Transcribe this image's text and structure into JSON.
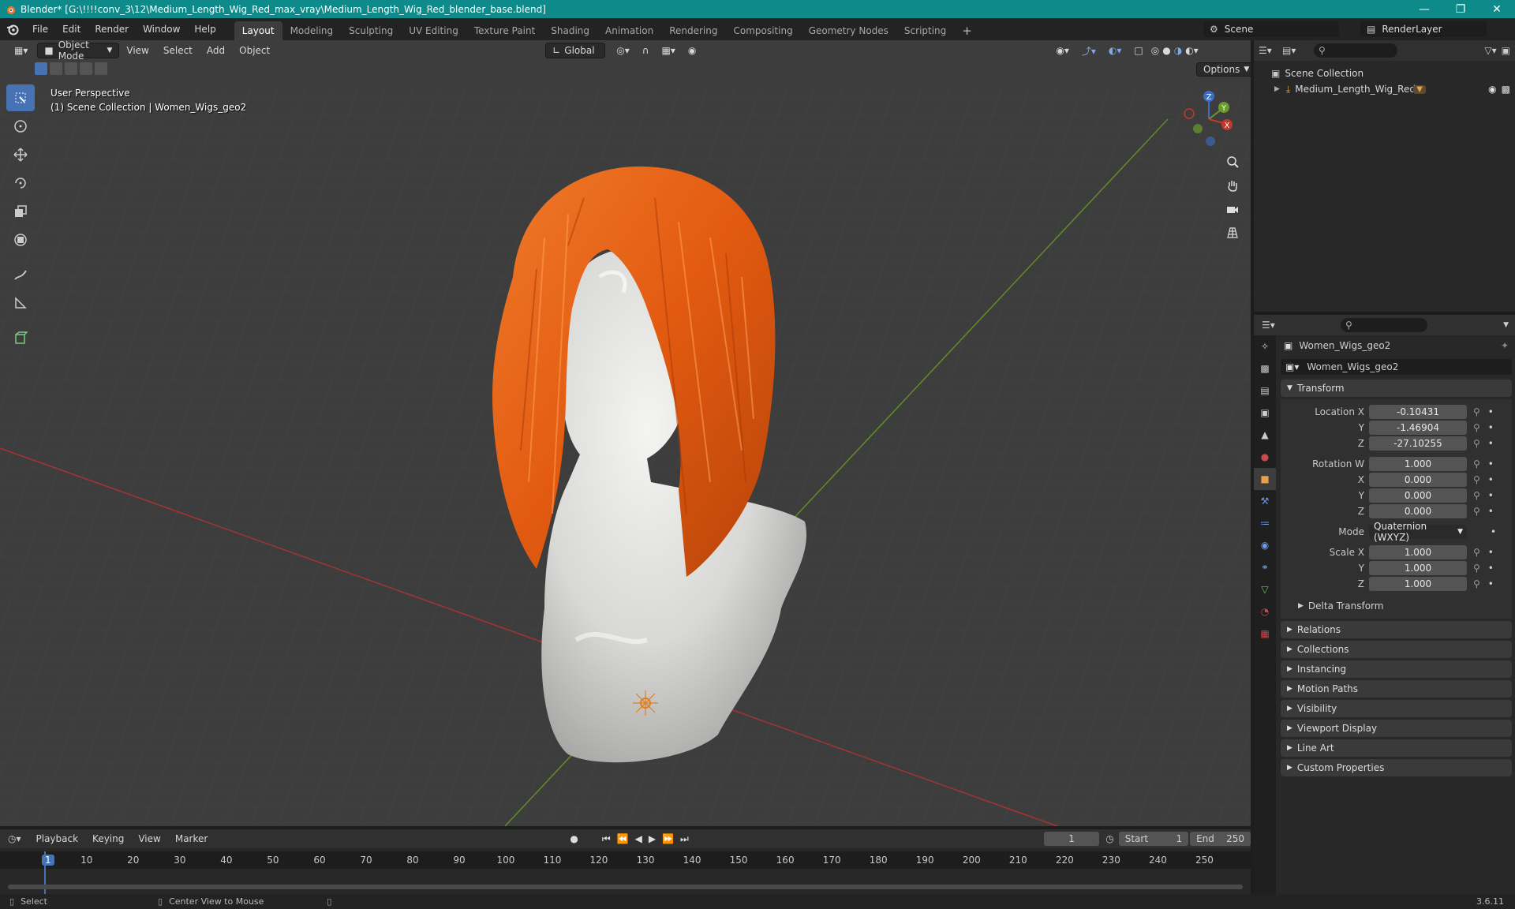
{
  "window": {
    "title": "Blender* [G:\\!!!!conv_3\\12\\Medium_Length_Wig_Red_max_vray\\Medium_Length_Wig_Red_blender_base.blend]"
  },
  "menus": [
    "File",
    "Edit",
    "Render",
    "Window",
    "Help"
  ],
  "workspace_tabs": [
    "Layout",
    "Modeling",
    "Sculpting",
    "UV Editing",
    "Texture Paint",
    "Shading",
    "Animation",
    "Rendering",
    "Compositing",
    "Geometry Nodes",
    "Scripting"
  ],
  "scene": {
    "name": "Scene",
    "render_layer": "RenderLayer"
  },
  "viewport": {
    "mode": "Object Mode",
    "menus": [
      "View",
      "Select",
      "Add",
      "Object"
    ],
    "orientation": "Global",
    "options": "Options",
    "info_line1": "User Perspective",
    "info_line2": "(1) Scene Collection | Women_Wigs_geo2",
    "gizmo": {
      "z": "Z",
      "y": "Y",
      "x": "X"
    }
  },
  "outliner": {
    "root": "Scene Collection",
    "items": [
      {
        "label": "Medium_Length_Wig_Red"
      }
    ]
  },
  "properties": {
    "object_name": "Women_Wigs_geo2",
    "data_name": "Women_Wigs_geo2",
    "transform_title": "Transform",
    "location_label": "Location X",
    "location": {
      "x": "-0.10431",
      "y": "-1.46904",
      "z": "-27.10255"
    },
    "rotation_label": "Rotation W",
    "rotation": {
      "w": "1.000",
      "x": "0.000",
      "y": "0.000",
      "z": "0.000"
    },
    "mode_label": "Mode",
    "mode_value": "Quaternion (WXYZ)",
    "scale_label": "Scale X",
    "scale": {
      "x": "1.000",
      "y": "1.000",
      "z": "1.000"
    },
    "axis": {
      "x": "X",
      "y": "Y",
      "z": "Z"
    },
    "delta": "Delta Transform",
    "panels": [
      "Relations",
      "Collections",
      "Instancing",
      "Motion Paths",
      "Visibility",
      "Viewport Display",
      "Line Art",
      "Custom Properties"
    ]
  },
  "timeline": {
    "menus": [
      "Playback",
      "Keying",
      "View",
      "Marker"
    ],
    "current_frame": "1",
    "start_label": "Start",
    "start": "1",
    "end_label": "End",
    "end": "250",
    "ticks": [
      "1",
      "10",
      "20",
      "30",
      "40",
      "50",
      "60",
      "70",
      "80",
      "90",
      "100",
      "110",
      "120",
      "130",
      "140",
      "150",
      "160",
      "170",
      "180",
      "190",
      "200",
      "210",
      "220",
      "230",
      "240",
      "250"
    ]
  },
  "status": {
    "select": "Select",
    "center": "Center View to Mouse",
    "version": "3.6.11"
  },
  "colors": {
    "accent": "#4772b3",
    "title_bar": "#0e8a8a",
    "hair": "#e8621a",
    "x_axis": "#c0392b",
    "y_axis": "#6a9a2a"
  }
}
